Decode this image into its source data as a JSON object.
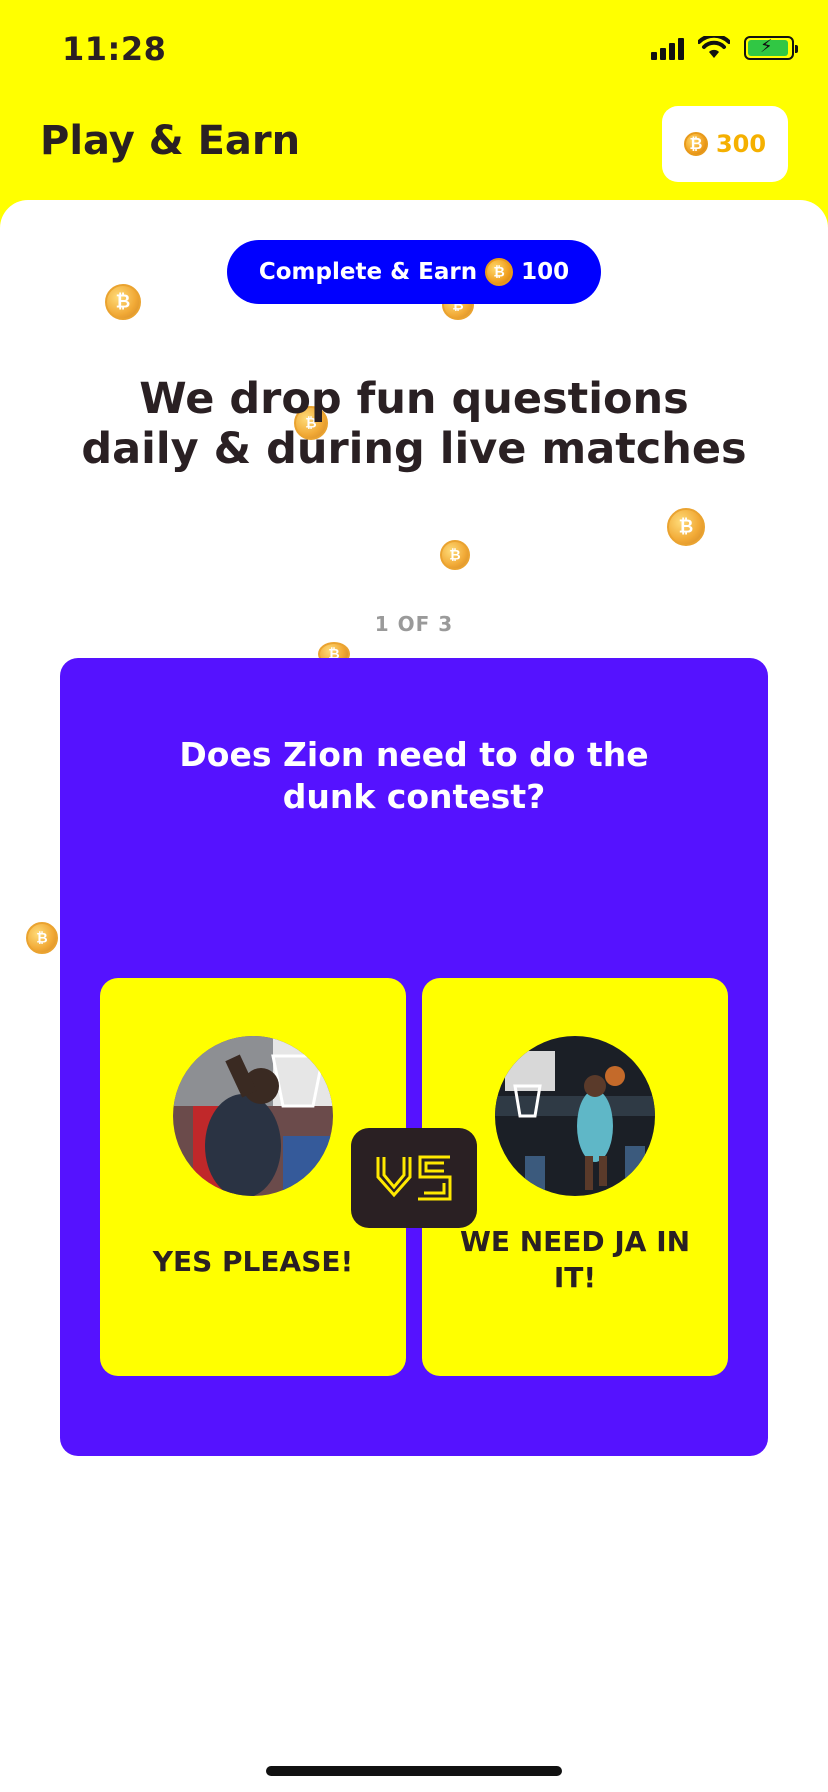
{
  "status_bar": {
    "time": "11:28",
    "icons": [
      "signal-icon",
      "wifi-icon",
      "battery-charging-icon"
    ]
  },
  "header": {
    "title": "Play & Earn",
    "coin_balance": "300",
    "coin_icon": "coin-icon"
  },
  "promo": {
    "label": "Complete & Earn",
    "reward": "100"
  },
  "headline": {
    "line1": "We drop fun questions",
    "line2": "daily & during live matches"
  },
  "pager": {
    "text": "1 OF 3"
  },
  "question_card": {
    "question_line1": "Does Zion need to do the",
    "question_line2": "dunk contest?",
    "options": [
      {
        "label": "YES PLEASE!"
      },
      {
        "label": "WE NEED JA IN IT!"
      }
    ],
    "vs_label": "VS"
  },
  "colors": {
    "header_bg": "#ffff00",
    "pill_blue": "#0000ff",
    "card_purple": "#5512ff",
    "option_yellow": "#ffff00",
    "text_dark": "#2a2023",
    "coin_gold": "#f5b000"
  }
}
